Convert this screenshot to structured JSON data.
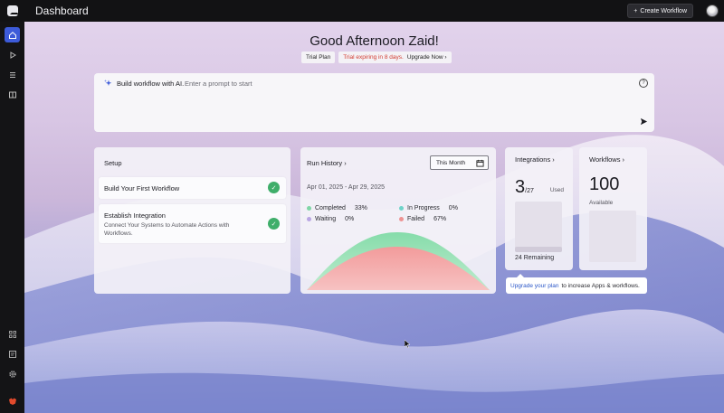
{
  "app": {
    "title": "Dashboard"
  },
  "topbar": {
    "create_label": "Create Workflow"
  },
  "sidebar": {
    "items": [
      {
        "icon": "home-icon",
        "active": true
      },
      {
        "icon": "play-icon",
        "active": false
      },
      {
        "icon": "list-icon",
        "active": false
      },
      {
        "icon": "book-icon",
        "active": false
      }
    ],
    "bottom_items": [
      {
        "icon": "apps-grid-icon"
      },
      {
        "icon": "message-icon"
      },
      {
        "icon": "gear-icon"
      },
      {
        "icon": "brand-logo-icon"
      }
    ]
  },
  "main": {
    "greeting": "Good Afternoon Zaid!",
    "plan": {
      "label": "Trial Plan",
      "warning": "Trial expiring in 8 days.",
      "upgrade": "Upgrade Now"
    },
    "prompt": {
      "title": "Build workflow with AI.",
      "placeholder": "Enter a prompt to start"
    },
    "setup": {
      "title": "Setup",
      "items": [
        {
          "name": "Build Your First Workflow",
          "desc": "",
          "done": true
        },
        {
          "name": "Establish Integration",
          "desc": "Connect Your Systems to Automate Actions with Workflows.",
          "done": true
        }
      ]
    },
    "run_history": {
      "title": "Run History",
      "period": "This Month",
      "date_range": "Apr 01, 2025 - Apr 29, 2025",
      "legend": [
        {
          "label": "Completed",
          "value": "33%",
          "color": "#7fd6a6"
        },
        {
          "label": "In Progress",
          "value": "0%",
          "color": "#6fd3c9"
        },
        {
          "label": "Waiting",
          "value": "0%",
          "color": "#b9a6e3"
        },
        {
          "label": "Failed",
          "value": "67%",
          "color": "#ee9393"
        }
      ]
    },
    "integrations": {
      "title": "Integrations",
      "used": "3",
      "total": "/27",
      "used_label": "Used",
      "remaining": "24 Remaining",
      "used_fraction": 0.11
    },
    "workflows": {
      "title": "Workflows",
      "count": "100",
      "available_label": "Available"
    },
    "tooltip": {
      "link": "Upgrade your plan",
      "text": "to increase Apps & workflows."
    }
  }
}
